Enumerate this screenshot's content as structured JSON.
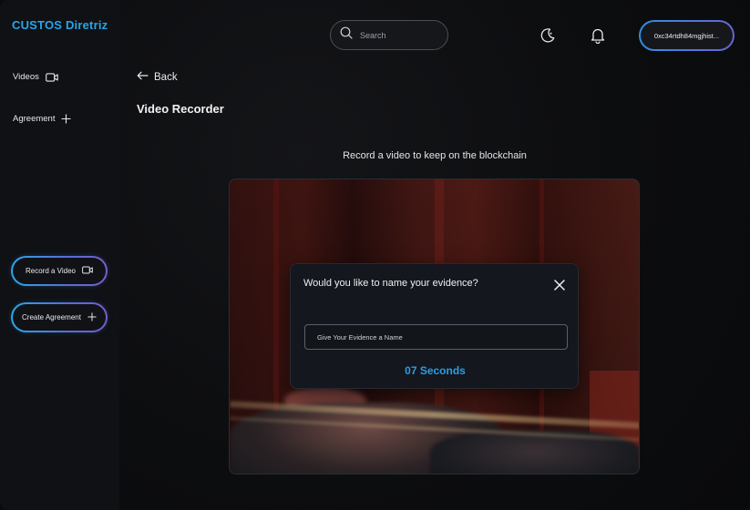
{
  "app": {
    "logo": "CUSTOS Diretriz",
    "accent": "#27a6e8"
  },
  "sidebar": {
    "items": [
      {
        "label": "Videos",
        "icon": "video-camera-icon"
      },
      {
        "label": "Agreement",
        "icon": "plus-icon"
      }
    ],
    "buttons": [
      {
        "label": "Record a Video",
        "icon": "video-camera-icon"
      },
      {
        "label": "Create Agreement",
        "icon": "plus-icon"
      }
    ]
  },
  "header": {
    "search": {
      "placeholder": "Search"
    },
    "icons": [
      "moon-icon",
      "bell-icon"
    ],
    "wallet": "0xc34rtdh84mgjhist..."
  },
  "main": {
    "back_label": "Back",
    "title": "Video Recorder",
    "subtitle": "Record a video to keep on the blockchain"
  },
  "dialog": {
    "title": "Would you like to name your evidence?",
    "input_placeholder": "Give Your Evidence a Name",
    "timer": "07 Seconds"
  }
}
